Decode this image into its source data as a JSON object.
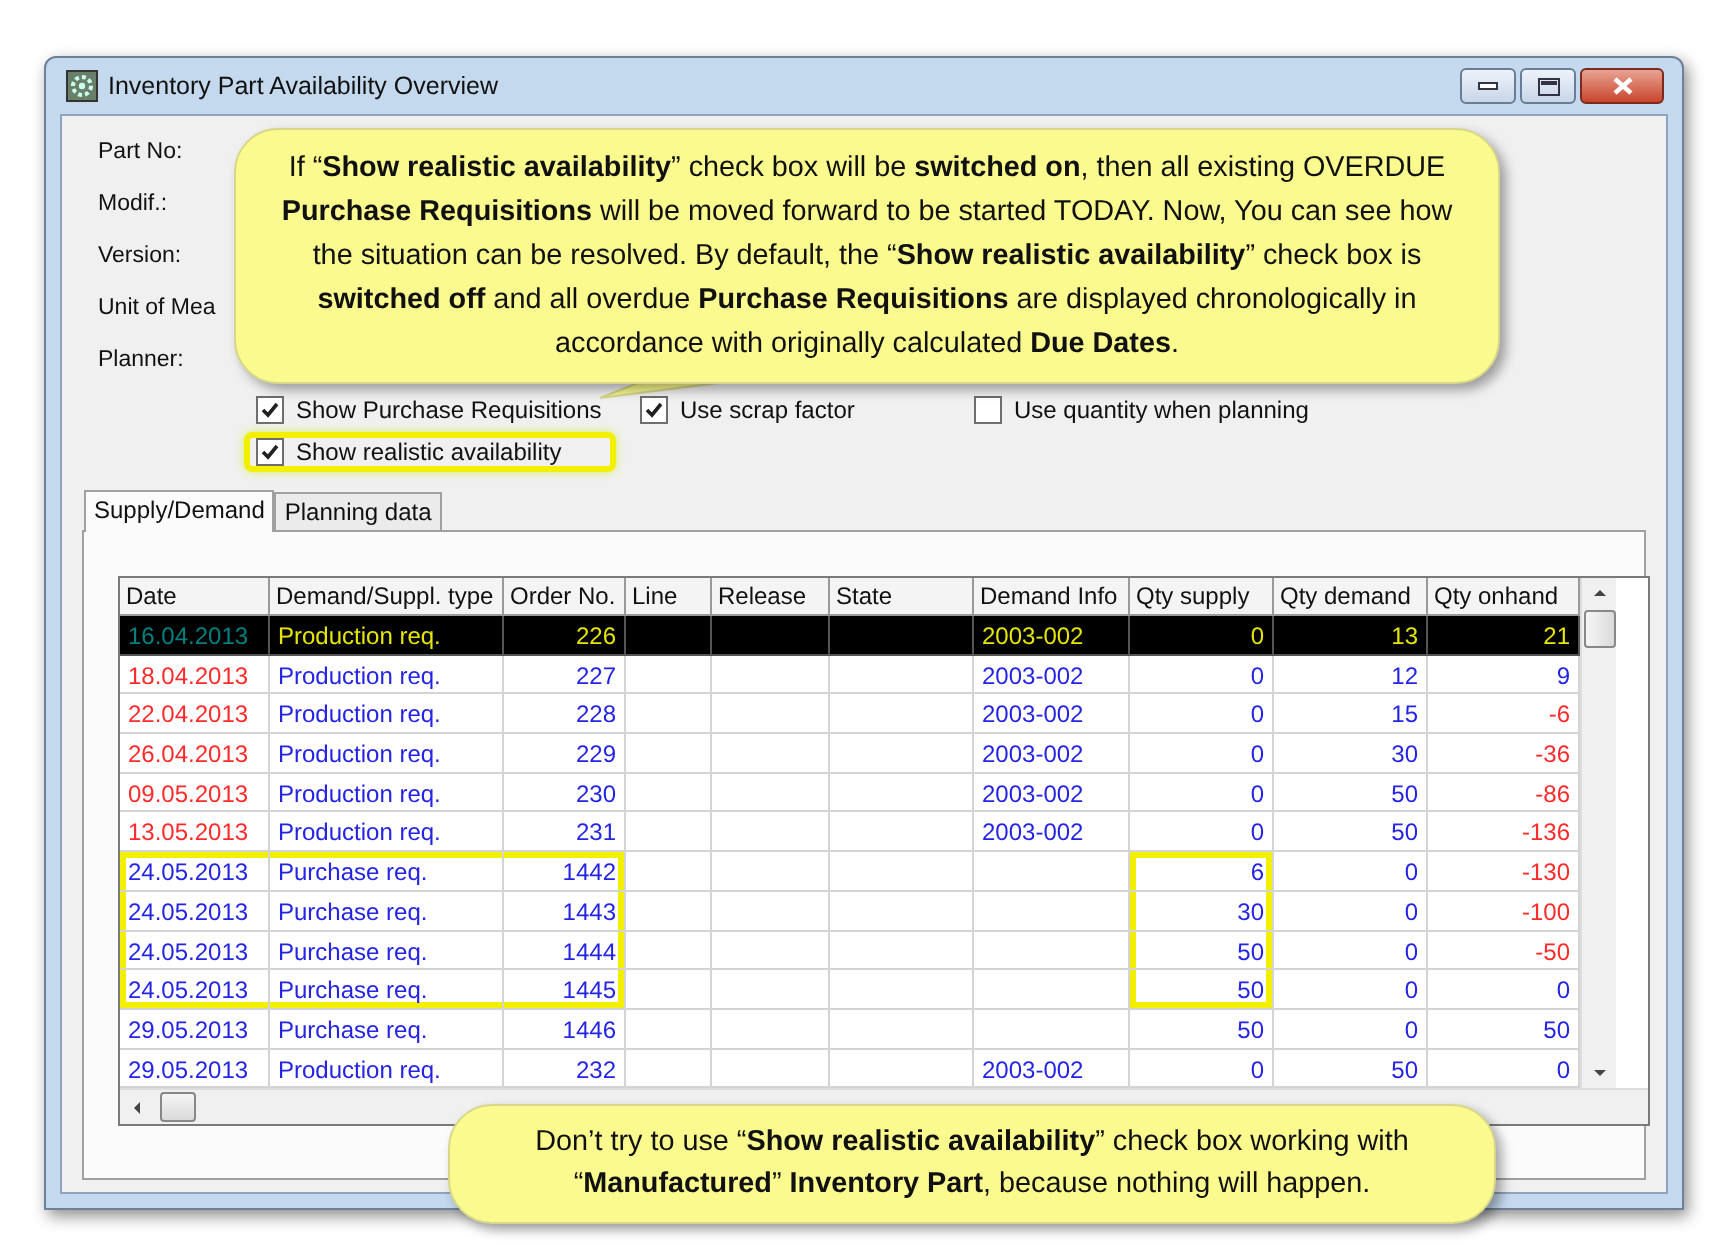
{
  "window": {
    "title": "Inventory Part Availability Overview"
  },
  "form": {
    "labels": [
      "Part No:",
      "Modif.:",
      "Version:",
      "Unit of Mea",
      "Planner:"
    ]
  },
  "checkboxes": [
    {
      "label": "Show Purchase Requisitions",
      "checked": true,
      "highlighted": false
    },
    {
      "label": "Use scrap factor",
      "checked": true,
      "highlighted": false
    },
    {
      "label": "Use quantity when planning",
      "checked": false,
      "highlighted": false
    },
    {
      "label": "Show realistic availability",
      "checked": true,
      "highlighted": true
    }
  ],
  "tabs": [
    {
      "label": "Supply/Demand",
      "selected": true
    },
    {
      "label": "Planning data",
      "selected": false
    }
  ],
  "table": {
    "columns": [
      {
        "label": "Date",
        "kind": "date",
        "highlighted": true
      },
      {
        "label": "Demand/Suppl. type",
        "kind": "text",
        "highlighted": true
      },
      {
        "label": "Order No.",
        "kind": "number",
        "highlighted": true
      },
      {
        "label": "Line",
        "kind": "text",
        "highlighted": false
      },
      {
        "label": "Release",
        "kind": "text",
        "highlighted": false
      },
      {
        "label": "State",
        "kind": "text",
        "highlighted": false
      },
      {
        "label": "Demand Info",
        "kind": "text",
        "highlighted": false
      },
      {
        "label": "Qty supply",
        "kind": "number",
        "highlighted": true
      },
      {
        "label": "Qty demand",
        "kind": "number",
        "highlighted": false
      },
      {
        "label": "Qty onhand",
        "kind": "balance",
        "highlighted": false
      }
    ],
    "rows": [
      {
        "selected": true,
        "overdue": false,
        "shortage": false,
        "highlighted": false,
        "cells": [
          "16.04.2013",
          "Production req.",
          "226",
          null,
          null,
          null,
          "2003-002",
          "0",
          "13",
          "21"
        ]
      },
      {
        "selected": false,
        "overdue": true,
        "shortage": false,
        "highlighted": false,
        "cells": [
          "18.04.2013",
          "Production req.",
          "227",
          null,
          null,
          null,
          "2003-002",
          "0",
          "12",
          "9"
        ]
      },
      {
        "selected": false,
        "overdue": true,
        "shortage": true,
        "highlighted": false,
        "cells": [
          "22.04.2013",
          "Production req.",
          "228",
          null,
          null,
          null,
          "2003-002",
          "0",
          "15",
          "-6"
        ]
      },
      {
        "selected": false,
        "overdue": true,
        "shortage": true,
        "highlighted": false,
        "cells": [
          "26.04.2013",
          "Production req.",
          "229",
          null,
          null,
          null,
          "2003-002",
          "0",
          "30",
          "-36"
        ]
      },
      {
        "selected": false,
        "overdue": true,
        "shortage": true,
        "highlighted": false,
        "cells": [
          "09.05.2013",
          "Production req.",
          "230",
          null,
          null,
          null,
          "2003-002",
          "0",
          "50",
          "-86"
        ]
      },
      {
        "selected": false,
        "overdue": true,
        "shortage": true,
        "highlighted": false,
        "cells": [
          "13.05.2013",
          "Production req.",
          "231",
          null,
          null,
          null,
          "2003-002",
          "0",
          "50",
          "-136"
        ]
      },
      {
        "selected": false,
        "overdue": false,
        "shortage": true,
        "highlighted": true,
        "cells": [
          "24.05.2013",
          "Purchase req.",
          "1442",
          null,
          null,
          null,
          null,
          "6",
          "0",
          "-130"
        ]
      },
      {
        "selected": false,
        "overdue": false,
        "shortage": true,
        "highlighted": true,
        "cells": [
          "24.05.2013",
          "Purchase req.",
          "1443",
          null,
          null,
          null,
          null,
          "30",
          "0",
          "-100"
        ]
      },
      {
        "selected": false,
        "overdue": false,
        "shortage": true,
        "highlighted": true,
        "cells": [
          "24.05.2013",
          "Purchase req.",
          "1444",
          null,
          null,
          null,
          null,
          "50",
          "0",
          "-50"
        ]
      },
      {
        "selected": false,
        "overdue": false,
        "shortage": false,
        "highlighted": true,
        "cells": [
          "24.05.2013",
          "Purchase req.",
          "1445",
          null,
          null,
          null,
          null,
          "50",
          "0",
          "0"
        ]
      },
      {
        "selected": false,
        "overdue": false,
        "shortage": false,
        "highlighted": false,
        "cells": [
          "29.05.2013",
          "Purchase req.",
          "1446",
          null,
          null,
          null,
          null,
          "50",
          "0",
          "50"
        ]
      },
      {
        "selected": false,
        "overdue": false,
        "shortage": false,
        "highlighted": false,
        "cells": [
          "29.05.2013",
          "Production req.",
          "232",
          null,
          null,
          null,
          "2003-002",
          "0",
          "50",
          "0"
        ]
      }
    ]
  },
  "callouts": [
    {
      "kind": "pointer",
      "text": "If “**Show realistic availability**” check box will be **switched on**, then all existing OVERDUE **Purchase Requisitions** will be moved forward to be started TODAY.  Now, You can see how the situation can be resolved.  By default, the “**Show realistic availability**” check box is **switched off** and all overdue **Purchase Requisitions** are displayed chronologically in accordance with originally calculated **Due Dates**."
    },
    {
      "kind": "plain",
      "text": "Don’t try to use “**Show realistic availability**” check box working with “**Manufactured**”  **Inventory Part**, because nothing will happen."
    }
  ]
}
